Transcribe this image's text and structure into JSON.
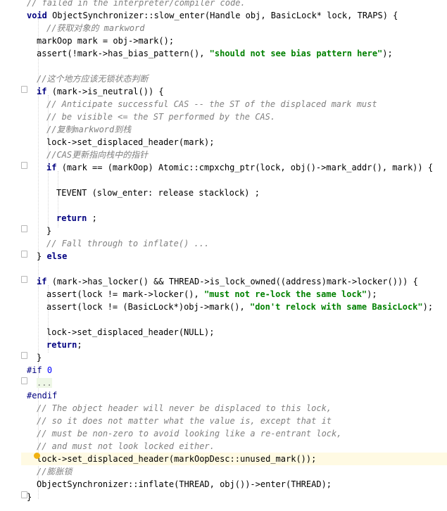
{
  "editor": {
    "lines": [
      {
        "text": "// failed in the interpreter/compiler code.",
        "type": "comment",
        "indent": 0
      },
      {
        "parts": [
          [
            "void ",
            "kw"
          ],
          [
            "ObjectSynchronizer::slow_enter(Handle obj, BasicLock* lock, TRAPS) {",
            ""
          ]
        ],
        "indent": 0
      },
      {
        "text": "//获取对象的 markword",
        "type": "comment",
        "indent": 4
      },
      {
        "parts": [
          [
            "markOop mark = obj->mark();",
            ""
          ]
        ],
        "indent": 2
      },
      {
        "parts": [
          [
            "assert(!mark->has_bias_pattern(), ",
            ""
          ],
          [
            "\"should not see bias pattern here\"",
            "st"
          ],
          [
            ");",
            ""
          ]
        ],
        "indent": 2
      },
      {
        "text": "",
        "indent": 0
      },
      {
        "text": "//这个地方应该无锁状态判断",
        "type": "comment",
        "indent": 2
      },
      {
        "parts": [
          [
            "if ",
            "kw"
          ],
          [
            "(mark->is_neutral()) {",
            ""
          ]
        ],
        "indent": 2
      },
      {
        "text": "// Anticipate successful CAS -- the ST of the displaced mark must",
        "type": "comment",
        "indent": 4
      },
      {
        "text": "// be visible <= the ST performed by the CAS.",
        "type": "comment",
        "indent": 4
      },
      {
        "text": "//复制markword到栈",
        "type": "comment",
        "indent": 4
      },
      {
        "parts": [
          [
            "lock->set_displaced_header(mark);",
            ""
          ]
        ],
        "indent": 4
      },
      {
        "text": "//CAS更新指向栈中的指针",
        "type": "comment",
        "indent": 4
      },
      {
        "parts": [
          [
            "if ",
            "kw"
          ],
          [
            "(mark == (markOop) Atomic::cmpxchg_ptr(lock, obj()->mark_addr(), mark)) {",
            ""
          ]
        ],
        "indent": 4
      },
      {
        "text": "",
        "indent": 0
      },
      {
        "parts": [
          [
            "TEVENT (slow_enter: release stacklock) ;",
            ""
          ]
        ],
        "indent": 6
      },
      {
        "text": "",
        "indent": 0
      },
      {
        "parts": [
          [
            "return ",
            "kw"
          ],
          [
            ";",
            ""
          ]
        ],
        "indent": 6
      },
      {
        "parts": [
          [
            "}",
            ""
          ]
        ],
        "indent": 4
      },
      {
        "text": "// Fall through to inflate() ...",
        "type": "comment",
        "indent": 4
      },
      {
        "parts": [
          [
            "} ",
            ""
          ],
          [
            "else",
            "kw"
          ]
        ],
        "indent": 2
      },
      {
        "text": "",
        "indent": 0
      },
      {
        "parts": [
          [
            "if ",
            "kw"
          ],
          [
            "(mark->has_locker() && THREAD->is_lock_owned((address)mark->locker())) {",
            ""
          ]
        ],
        "indent": 2
      },
      {
        "parts": [
          [
            "assert(lock != mark->locker(), ",
            ""
          ],
          [
            "\"must not re-lock the same lock\"",
            "st"
          ],
          [
            ");",
            ""
          ]
        ],
        "indent": 4
      },
      {
        "parts": [
          [
            "assert(lock != (BasicLock*)obj->mark(), ",
            ""
          ],
          [
            "\"don't relock with same BasicLock\"",
            "st"
          ],
          [
            ");",
            ""
          ]
        ],
        "indent": 4
      },
      {
        "text": "",
        "indent": 0
      },
      {
        "parts": [
          [
            "lock->set_displaced_header(NULL);",
            ""
          ]
        ],
        "indent": 4
      },
      {
        "parts": [
          [
            "return",
            "kw"
          ],
          [
            ";",
            ""
          ]
        ],
        "indent": 4
      },
      {
        "parts": [
          [
            "}",
            ""
          ]
        ],
        "indent": 2
      },
      {
        "parts": [
          [
            "#if ",
            "pp"
          ],
          [
            "0",
            "num"
          ]
        ],
        "indent": 0
      },
      {
        "parts": [
          [
            "...",
            "inactive"
          ]
        ],
        "indent": 2
      },
      {
        "parts": [
          [
            "#endif",
            "pp"
          ]
        ],
        "indent": 0
      },
      {
        "text": "// The object header will never be displaced to this lock,",
        "type": "comment",
        "indent": 2
      },
      {
        "text": "// so it does not matter what the value is, except that it",
        "type": "comment",
        "indent": 2
      },
      {
        "text": "// must be non-zero to avoid looking like a re-entrant lock,",
        "type": "comment",
        "indent": 2
      },
      {
        "text": "// and must not look locked either.",
        "type": "comment",
        "indent": 2
      },
      {
        "parts": [
          [
            "lock->set_displaced_header(markOopDesc::unused_mark());",
            ""
          ]
        ],
        "indent": 2,
        "highlight": true
      },
      {
        "text": "//膨胀锁",
        "type": "comment",
        "indent": 2
      },
      {
        "parts": [
          [
            "ObjectSynchronizer::inflate(THREAD, obj())->enter(THREAD);",
            ""
          ]
        ],
        "indent": 2
      },
      {
        "parts": [
          [
            "}",
            ""
          ]
        ],
        "indent": 0
      }
    ]
  }
}
